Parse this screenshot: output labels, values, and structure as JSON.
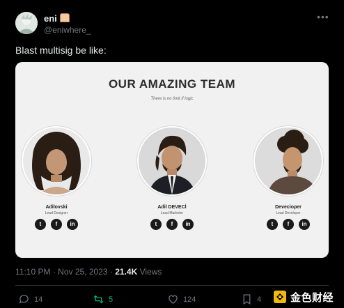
{
  "post": {
    "display_name": "eni",
    "handle": "@eniwhere_",
    "text": "Blast multisig be like:",
    "more_icon": "more-icon"
  },
  "card": {
    "title": "OUR AMAZING TEAM",
    "subtitle": "There is no limit if logic",
    "members": [
      {
        "name": "Adilovski",
        "role": "Lead Designer"
      },
      {
        "name": "Adil DEVECİ",
        "role": "Lead Marketer"
      },
      {
        "name": "Devecioper",
        "role": "Lead Developer"
      }
    ],
    "social_icons": [
      "twitter-icon",
      "facebook-icon",
      "linkedin-icon"
    ]
  },
  "meta": {
    "time": "11:10 PM",
    "sep": "·",
    "date": "Nov 25, 2023",
    "views_count": "21.4K",
    "views_label": "Views"
  },
  "actions": {
    "replies": "14",
    "reposts": "5",
    "likes": "124",
    "bookmarks": "4"
  },
  "watermark": {
    "text": "金色财经"
  },
  "colors": {
    "background": "#000000",
    "text": "#e7e9ea",
    "muted": "#71767b",
    "repost_active": "#00ba7c",
    "watermark_gold": "#f0b90b"
  }
}
